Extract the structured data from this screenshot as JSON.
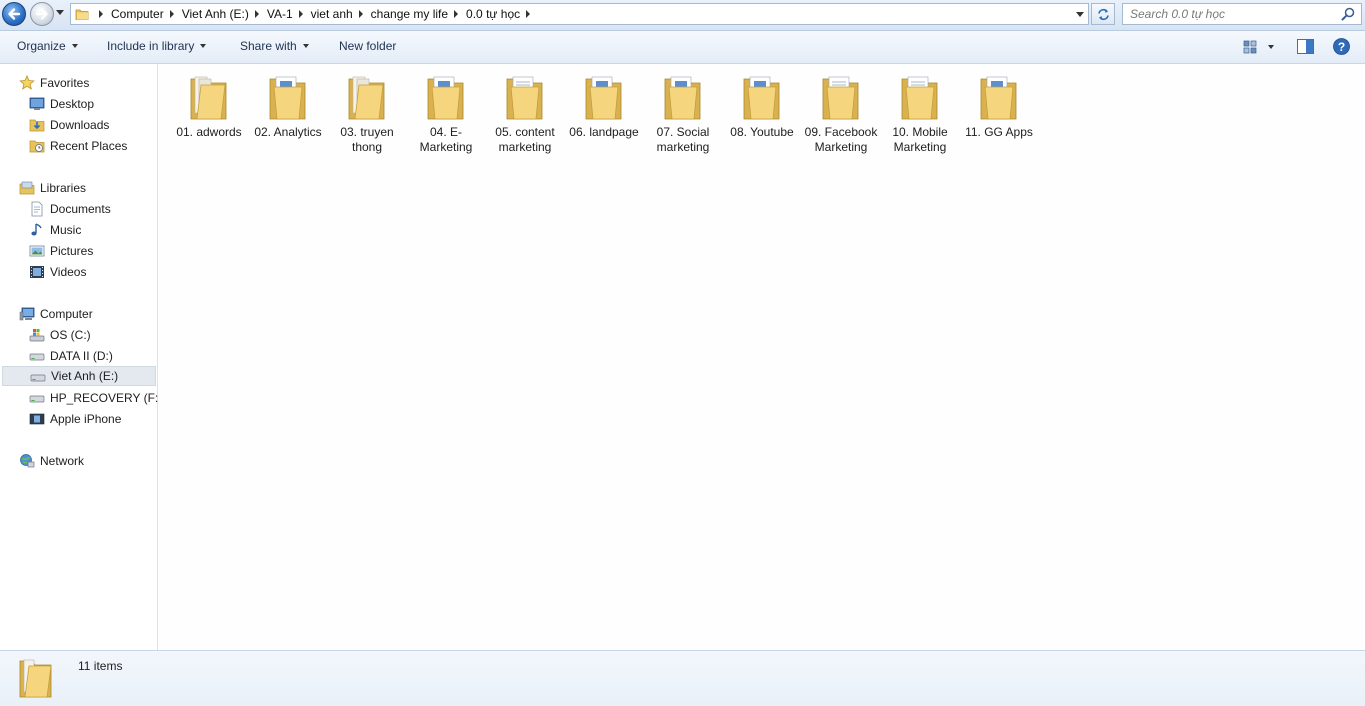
{
  "address_bar": {
    "breadcrumbs": [
      "Computer",
      "Viet Anh (E:)",
      "VA-1",
      "viet anh",
      "change my life",
      "0.0 tự học"
    ]
  },
  "search": {
    "placeholder": "Search 0.0 tự học"
  },
  "toolbar": {
    "organize": "Organize",
    "include_in_library": "Include in library",
    "share_with": "Share with",
    "new_folder": "New folder"
  },
  "nav": {
    "favorites": "Favorites",
    "desktop": "Desktop",
    "downloads": "Downloads",
    "recent_places": "Recent Places",
    "libraries": "Libraries",
    "documents": "Documents",
    "music": "Music",
    "pictures": "Pictures",
    "videos": "Videos",
    "computer": "Computer",
    "os_c": "OS (C:)",
    "data_d": "DATA II (D:)",
    "viet_anh_e": "Viet Anh (E:)",
    "hp_recovery_f": "HP_RECOVERY (F:)",
    "apple_iphone": "Apple iPhone",
    "network": "Network"
  },
  "folders": [
    "01. adwords",
    "02. Analytics",
    "03. truyen thong",
    "04. E-Marketing",
    "05. content marketing",
    "06. landpage",
    "07. Social marketing",
    "08. Youtube",
    "09. Facebook Marketing",
    "10. Mobile Marketing",
    "11. GG Apps"
  ],
  "status": {
    "item_count": "11 items"
  },
  "colors": {
    "folder": "#f3d27a",
    "accent": "#2a6cc2"
  }
}
